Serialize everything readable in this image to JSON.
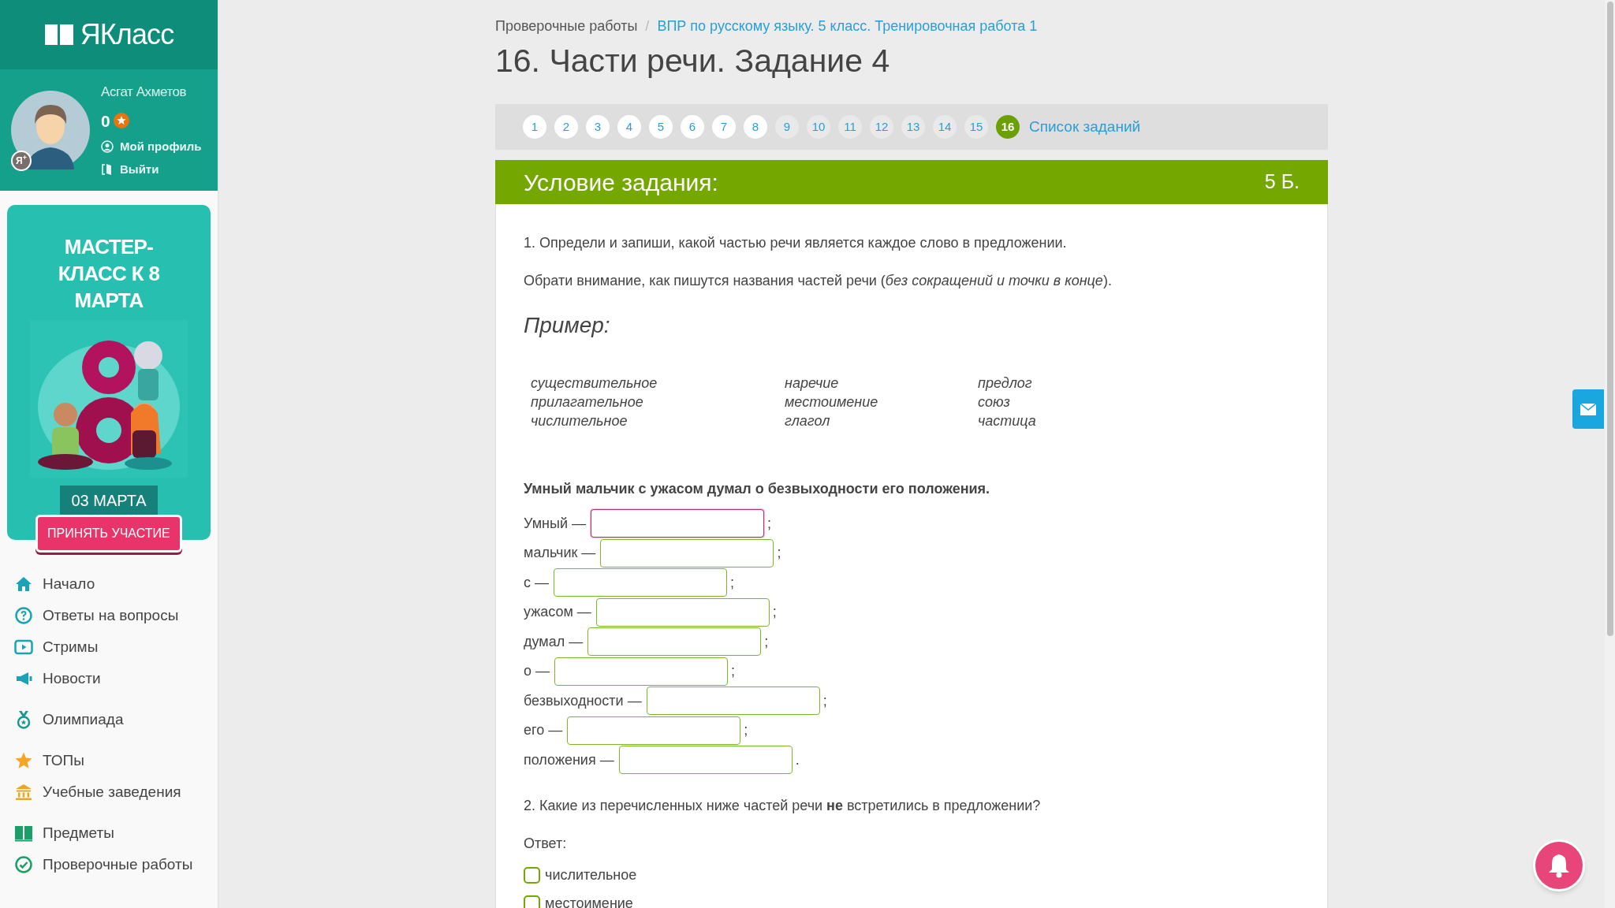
{
  "logo": {
    "text": "ЯКласс"
  },
  "profile": {
    "name": "Асгат Ахметов",
    "score": "0",
    "badge": "Я$^{+}$",
    "links": [
      "Мой профиль",
      "Выйти"
    ]
  },
  "banner": {
    "title": "МАСТЕР-КЛАСС К 8 МАРТА",
    "date": "03 МАРТА",
    "button": "ПРИНЯТЬ УЧАСТИЕ",
    "kind": "picture"
  },
  "nav_groups": [
    [
      {
        "label": "Начало"
      },
      {
        "label": "Ответы на вопросы"
      },
      {
        "label": "Стримы"
      },
      {
        "label": "Новости"
      }
    ],
    [
      {
        "label": "Олимпиада"
      }
    ],
    [
      {
        "label": "ТОПы"
      },
      {
        "label": "Учебные заведения"
      }
    ],
    [
      {
        "label": "Предметы"
      },
      {
        "label": "Проверочные работы"
      }
    ]
  ],
  "breadcrumb": [
    "Проверочные работы",
    "ВПР по русскому языку. 5 класс. Тренировочная работа 1"
  ],
  "breadcrumb_separator": "/",
  "title": "16. Части речи. Задание 4",
  "pager": {
    "pages": [
      {
        "label": "1",
        "visited": true,
        "selected": false
      },
      {
        "label": "2",
        "visited": true,
        "selected": false
      },
      {
        "label": "3",
        "visited": true,
        "selected": false
      },
      {
        "label": "4",
        "visited": true,
        "selected": false
      },
      {
        "label": "5",
        "visited": true,
        "selected": false
      },
      {
        "label": "6",
        "visited": true,
        "selected": false
      },
      {
        "label": "7",
        "visited": true,
        "selected": false
      },
      {
        "label": "8",
        "visited": true,
        "selected": false
      },
      {
        "label": "9",
        "visited": false,
        "selected": false
      },
      {
        "label": "10",
        "visited": false,
        "selected": false
      },
      {
        "label": "11",
        "visited": false,
        "selected": false
      },
      {
        "label": "12",
        "visited": false,
        "selected": false
      },
      {
        "label": "13",
        "visited": false,
        "selected": false
      },
      {
        "label": "14",
        "visited": false,
        "selected": false
      },
      {
        "label": "15",
        "visited": false,
        "selected": false
      },
      {
        "label": "16",
        "visited": true,
        "selected": true
      }
    ],
    "list_link": "Список заданий"
  },
  "task": {
    "header": "Условие задания:",
    "points": "5 Б.",
    "paragraphs": [
      "1. Определи и запиши, какой частью речи является каждое слово в предложении.",
      "Обрати внимание, как пишутся названия частей речи (*без сокращений и точки в конце*)."
    ],
    "example_title": "Пример:",
    "example_columns": [
      [
        "существительное",
        "прилагательное",
        "числительное"
      ],
      [
        "наречие",
        "местоимение",
        "глагол"
      ],
      [
        "предлог",
        "союз",
        "частица"
      ]
    ],
    "sentence": "Умный мальчик с ужасом думал о безвыходности его положения.",
    "fills": [
      {
        "word": "Умный —",
        "end": ";",
        "focused": true
      },
      {
        "word": "мальчик —",
        "end": ";",
        "focused": false
      },
      {
        "word": "с —",
        "end": ";",
        "focused": false
      },
      {
        "word": "ужасом —",
        "end": ";",
        "focused": false
      },
      {
        "word": "думал —",
        "end": ";",
        "focused": false
      },
      {
        "word": "о —",
        "end": ";",
        "focused": false
      },
      {
        "word": "безвыходности —",
        "end": ";",
        "focused": false
      },
      {
        "word": "его —",
        "end": ";",
        "focused": false
      },
      {
        "word": "положения —",
        "end": ".",
        "focused": false
      }
    ],
    "question2": "2. Какие из перечисленных ниже частей речи **не** встретились в предложении?",
    "answer_label": "Ответ:",
    "options": [
      {
        "label": "числительное",
        "checked": false
      },
      {
        "label": "местоимение",
        "checked": false
      }
    ]
  }
}
